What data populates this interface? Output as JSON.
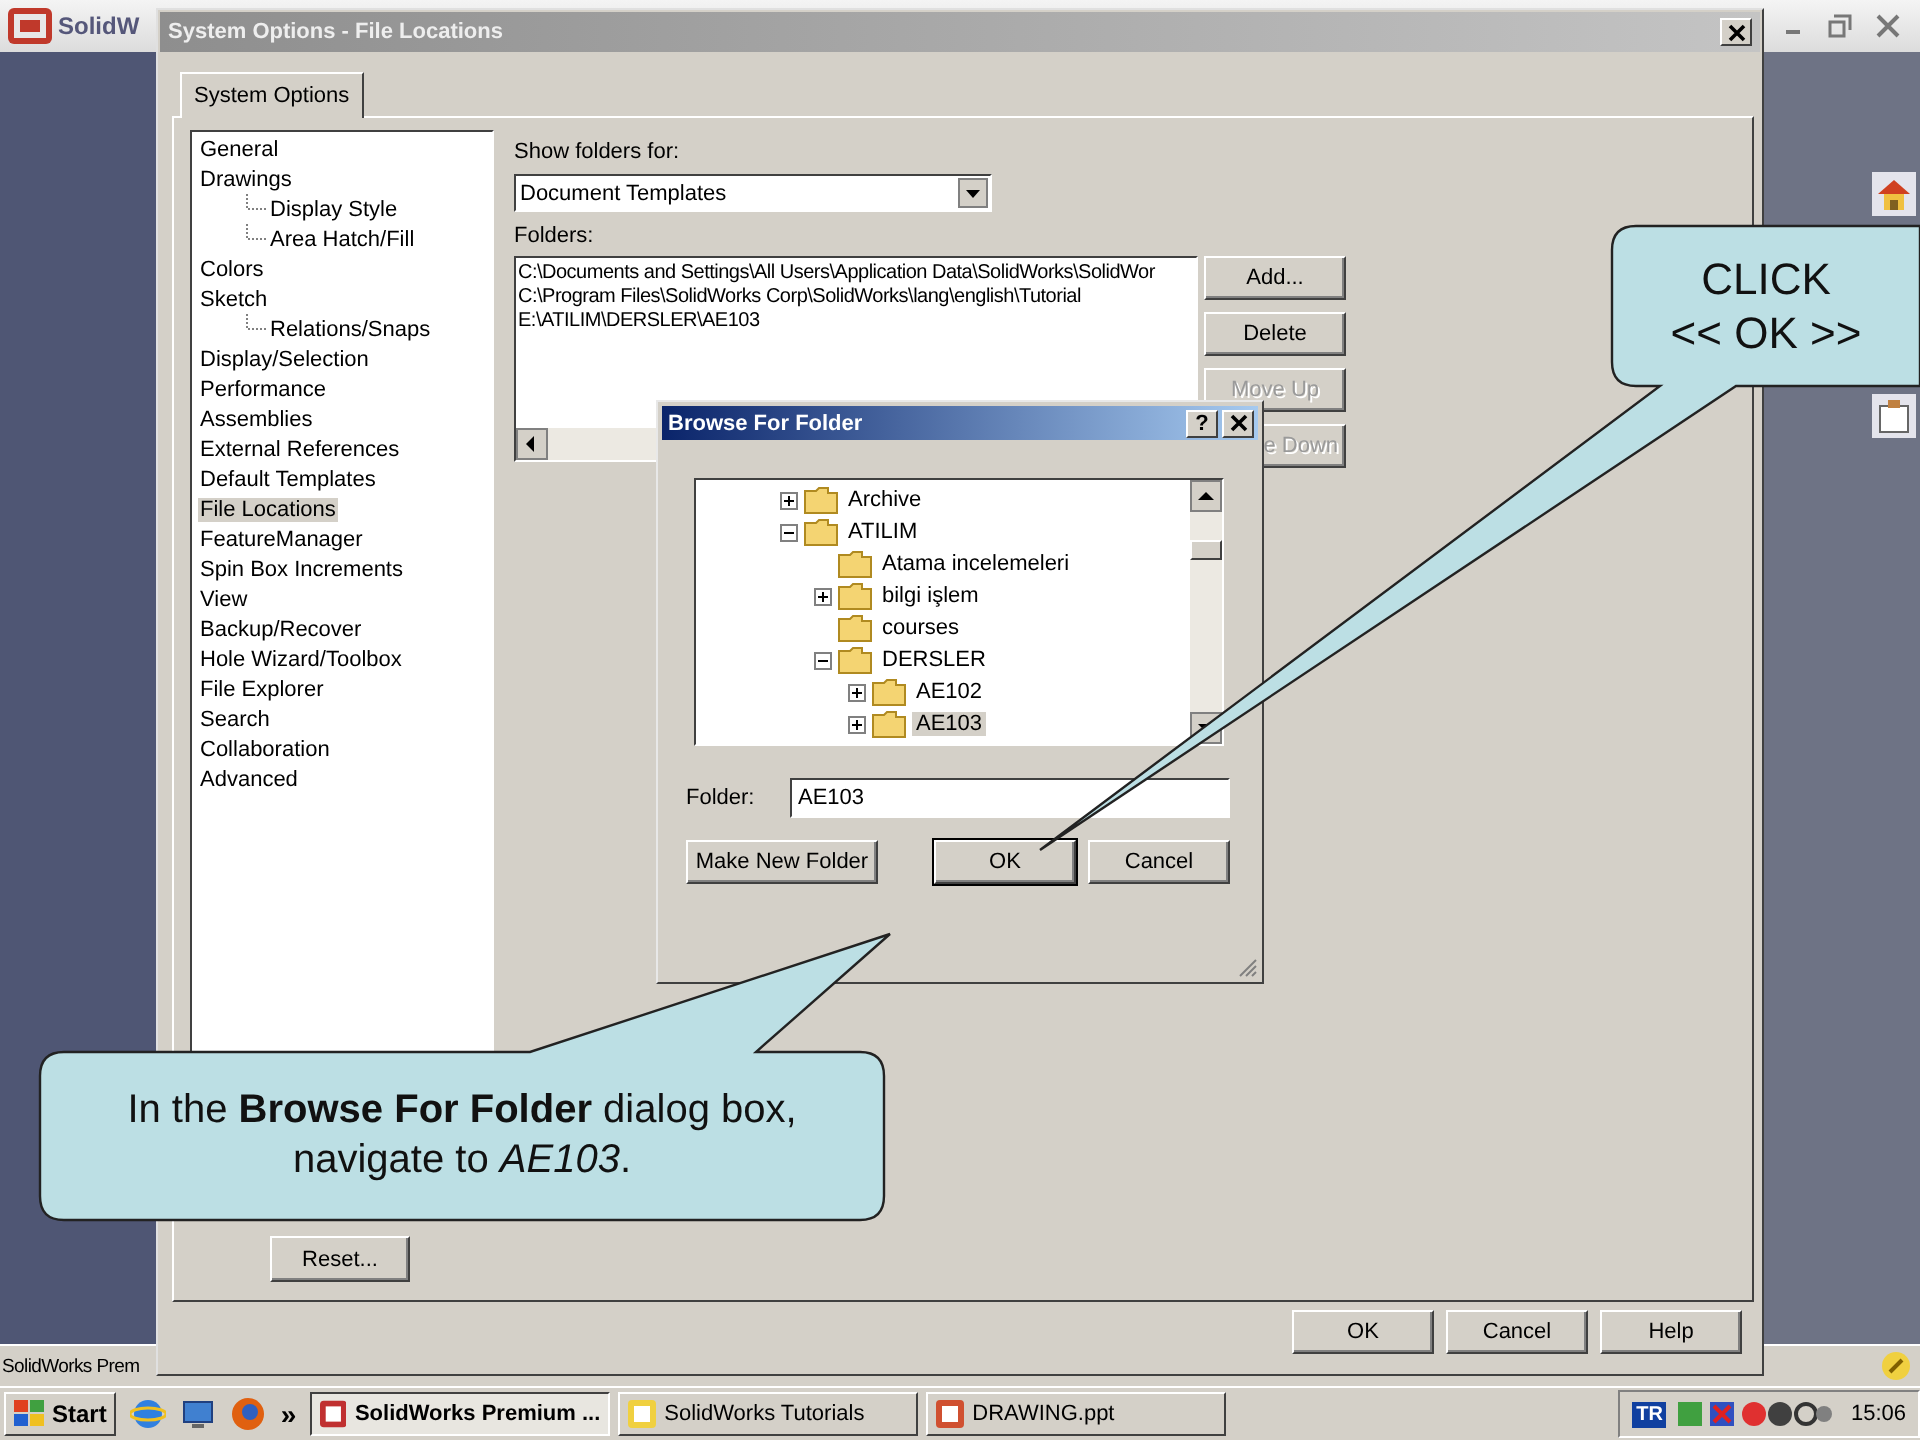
{
  "app": {
    "title": "SolidW",
    "status": "SolidWorks Prem"
  },
  "dialog": {
    "title": "System Options - File Locations",
    "tabs": [
      {
        "label": "System Options",
        "selected": true
      }
    ],
    "categories": [
      {
        "label": "General",
        "selected": false
      },
      {
        "label": "Drawings",
        "selected": false,
        "children": [
          {
            "label": "Display Style",
            "selected": false
          },
          {
            "label": "Area Hatch/Fill",
            "selected": false
          }
        ]
      },
      {
        "label": "Colors",
        "selected": false
      },
      {
        "label": "Sketch",
        "selected": false,
        "children": [
          {
            "label": "Relations/Snaps",
            "selected": false
          }
        ]
      },
      {
        "label": "Display/Selection",
        "selected": false
      },
      {
        "label": "Performance",
        "selected": false
      },
      {
        "label": "Assemblies",
        "selected": false
      },
      {
        "label": "External References",
        "selected": false
      },
      {
        "label": "Default Templates",
        "selected": false
      },
      {
        "label": "File Locations",
        "selected": true
      },
      {
        "label": "FeatureManager",
        "selected": false
      },
      {
        "label": "Spin Box Increments",
        "selected": false
      },
      {
        "label": "View",
        "selected": false
      },
      {
        "label": "Backup/Recover",
        "selected": false
      },
      {
        "label": "Hole Wizard/Toolbox",
        "selected": false
      },
      {
        "label": "File Explorer",
        "selected": false
      },
      {
        "label": "Search",
        "selected": false
      },
      {
        "label": "Collaboration",
        "selected": false
      },
      {
        "label": "Advanced",
        "selected": false
      }
    ],
    "show_folders_label": "Show folders for:",
    "show_folders_value": "Document Templates",
    "folders_label": "Folders:",
    "folders": [
      "C:\\Documents and Settings\\All Users\\Application Data\\SolidWorks\\SolidWor",
      "C:\\Program Files\\SolidWorks Corp\\SolidWorks\\lang\\english\\Tutorial",
      "E:\\ATILIM\\DERSLER\\AE103"
    ],
    "side_buttons": [
      {
        "label": "Add...",
        "disabled": false
      },
      {
        "label": "Delete",
        "disabled": false
      },
      {
        "label": "Move Up",
        "disabled": true
      },
      {
        "label": "e Down",
        "disabled": true
      }
    ],
    "reset_button": "Reset...",
    "footer_buttons": [
      "OK",
      "Cancel",
      "Help"
    ]
  },
  "browse": {
    "title": "Browse For Folder",
    "help": "?",
    "tree": [
      {
        "label": "Archive",
        "expanded": false,
        "selected": false
      },
      {
        "label": "ATILIM",
        "expanded": true,
        "selected": false,
        "children": [
          {
            "label": "Atama incelemeleri",
            "selected": false
          },
          {
            "label": "bilgi işlem",
            "expanded": false,
            "selected": false
          },
          {
            "label": "courses",
            "selected": false
          },
          {
            "label": "DERSLER",
            "expanded": true,
            "selected": false,
            "children": [
              {
                "label": "AE102",
                "expanded": false,
                "selected": false
              },
              {
                "label": "AE103",
                "expanded": false,
                "selected": true
              }
            ]
          }
        ]
      }
    ],
    "folder_label": "Folder:",
    "folder_value": "AE103",
    "buttons": [
      {
        "label": "Make New Folder",
        "default": false
      },
      {
        "label": "OK",
        "default": true
      },
      {
        "label": "Cancel",
        "default": false
      }
    ]
  },
  "callouts": [
    {
      "lines": [
        "CLICK",
        "<< OK >>"
      ]
    },
    {
      "text": "In the **Browse For Folder** dialog box, navigate to *AE103*."
    }
  ],
  "taskbar": {
    "start": "Start",
    "chevron": "»",
    "tasks": [
      {
        "label": "SolidWorks Premium ...",
        "selected": true
      },
      {
        "label": "SolidWorks Tutorials",
        "selected": false
      },
      {
        "label": "DRAWING.ppt",
        "selected": false
      }
    ],
    "language": "TR",
    "clock": "15:06"
  }
}
